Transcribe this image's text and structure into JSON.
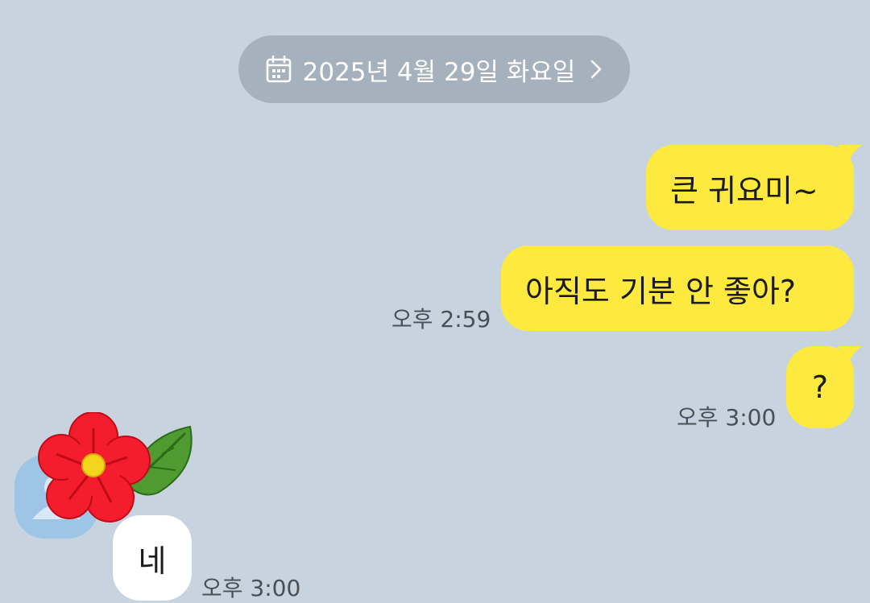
{
  "date_header": {
    "label": "2025년 4월 29일 화요일",
    "icon": "calendar-icon",
    "chevron": "chevron-right-icon"
  },
  "messages": [
    {
      "sender": "me",
      "text": "큰 귀요미~"
    },
    {
      "sender": "me",
      "text": "아직도 기분 안 좋아?",
      "time": "오후 2:59"
    },
    {
      "sender": "me",
      "text": "?",
      "time": "오후 3:00"
    },
    {
      "sender": "them",
      "text": "네",
      "time": "오후 3:00"
    }
  ],
  "colors": {
    "background": "#c7d4df",
    "my_bubble": "#fee93f",
    "their_bubble": "#ffffff",
    "date_pill": "#a5b1bd"
  }
}
